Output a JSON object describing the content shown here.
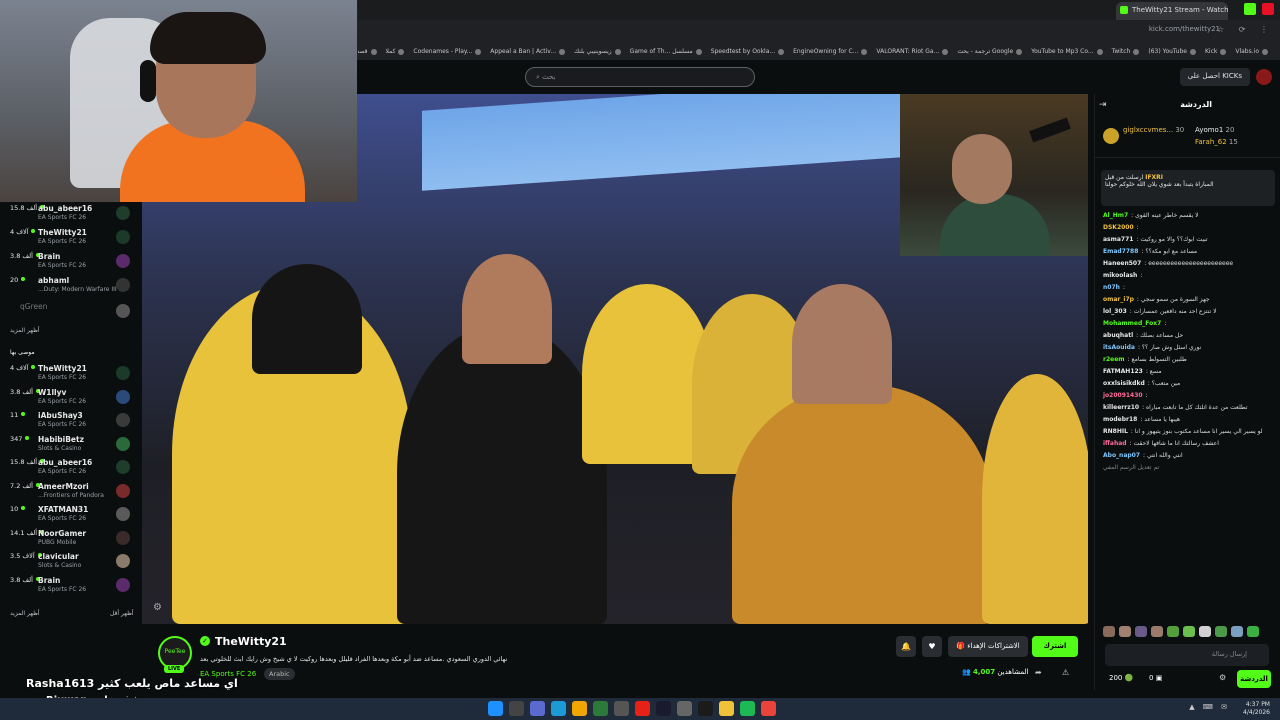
{
  "browser": {
    "tab_title": "TheWitty21 Stream - Watch",
    "url": "kick.com/thewitty21",
    "bookmarks": [
      "Vlabs.io",
      "Kick",
      "(63) YouTube",
      "Twitch",
      "YouTube to Mp3 Co...",
      "ترجمة - بحث Google",
      "VALORANT: Riot Ga...",
      "EngineOwning for C...",
      "Speedtest by Ookla...",
      "Game of Th... مسلسل",
      "زيسوينيبي بلنك",
      "Appeal a Ban | Activ...",
      "Codenames - Play...",
      "كملا",
      "قصه عشق"
    ]
  },
  "kick_nav": {
    "search_placeholder": "بحث",
    "get_kicks_label": "احصل على KICKs"
  },
  "sidebar": {
    "channels_top": [
      {
        "name": "abu_abeer16",
        "viewers": "15.8 ألف",
        "game": "EA Sports FC 26",
        "avatar": "#1e3d2a"
      },
      {
        "name": "TheWitty21",
        "viewers": "4 آلاف",
        "game": "EA Sports FC 26",
        "avatar": "#1b3a2a"
      },
      {
        "name": "Brain",
        "viewers": "3.8 ألف",
        "game": "EA Sports FC 26",
        "avatar": "#5a2a6a"
      },
      {
        "name": "abhaml",
        "viewers": "20",
        "game": "...Duty: Modern Warfare III",
        "avatar": "#333"
      }
    ],
    "offline_name": "qGreen",
    "show_more_1": "أظهر المزيد",
    "recommended_label": "موصى بها",
    "channels_recommended": [
      {
        "name": "TheWitty21",
        "viewers": "4 آلاف",
        "game": "EA Sports FC 26",
        "avatar": "#1b3a2a"
      },
      {
        "name": "W1llyv",
        "viewers": "3.8 ألف",
        "game": "EA Sports FC 26",
        "avatar": "#2a4a7a"
      },
      {
        "name": "iAbuShay3",
        "viewers": "11",
        "game": "EA Sports FC 26",
        "avatar": "#3a3a3a"
      },
      {
        "name": "HabibiBetz",
        "viewers": "347",
        "game": "Slots & Casino",
        "avatar": "#2a6a3a"
      },
      {
        "name": "abu_abeer16",
        "viewers": "15.8 ألف",
        "game": "EA Sports FC 26",
        "avatar": "#1e3d2a"
      },
      {
        "name": "AmeerMzori",
        "viewers": "7.2 ألف",
        "game": "...Frontiers of Pandora",
        "avatar": "#7a2a2a"
      },
      {
        "name": "XFATMAN31",
        "viewers": "10",
        "game": "EA Sports FC 26",
        "avatar": "#5a5a5a"
      },
      {
        "name": "NoorGamer",
        "viewers": "14.1 ألف",
        "game": "PUBG Mobile",
        "avatar": "#3a2a2a"
      },
      {
        "name": "clavicular",
        "viewers": "3.5 آلاف",
        "game": "Slots & Casino",
        "avatar": "#8a7a6a"
      },
      {
        "name": "Brain",
        "viewers": "3.8 ألف",
        "game": "EA Sports FC 26",
        "avatar": "#5a2a6a"
      }
    ],
    "show_more_2": "أظهر المزيد",
    "show_less": "أظهر أقل"
  },
  "stream": {
    "streamer_name": "TheWitty21",
    "avatar_text": "PeeTee",
    "live_label": "LIVE",
    "title": "نهائي الدوري السعودي .مساعد ضد أبو مكة وبعدها الفراد قليلل وبعدها روكيت لا ي شيخ وش رايك ابث للخلوتي بعد",
    "category": "EA Sports FC 26",
    "language": "Arabic",
    "subscribe_label": "اشترك",
    "gift_label": "الاشتراكات الإهداء",
    "viewers_label": "المشاهدين",
    "viewer_count": "4,007"
  },
  "overlay": {
    "line1_name": "Rasha1613",
    "line1_text": "اي مساعد ماص يلعب كثير",
    "line2_name": "Rjuwan",
    "line2_text": "شف خاص"
  },
  "chat": {
    "title": "الدردشة",
    "leaderboard": [
      {
        "name": "giglxccvmes...",
        "count": "30",
        "color": "#f0c23a"
      },
      {
        "name": "Ayomo1",
        "count": "20",
        "color": "#e8e8e8"
      },
      {
        "name": "Farah_62",
        "count": "15",
        "color": "#f0c23a"
      }
    ],
    "pinned_user": "IFXRI",
    "pinned_text": "المباراة بتبدأ بعد شوي يلان الله خلوكم حولنا",
    "pinned_sub": "ارسلت من قبل",
    "messages": [
      {
        "user": "Al_Hm7",
        "color": "#53fc18",
        "text": "لا يقسم خاطر عينه القوى"
      },
      {
        "user": "DSK2000",
        "color": "#f0c23a",
        "text": ""
      },
      {
        "user": "asma771",
        "color": "#e8e8e8",
        "text": "تبيت ابوك؟؟ والا مو روكيت"
      },
      {
        "user": "Emad7788",
        "color": "#7ec8ff",
        "text": "مساعد مع ابو مكة؟؟"
      },
      {
        "user": "Haneen507",
        "color": "#e8e8e8",
        "text": "eeeeeeeeeeeeeeeeeeeeeee"
      },
      {
        "user": "mikoolash",
        "color": "#e8e8e8",
        "text": ""
      },
      {
        "user": "n07h",
        "color": "#7ec8ff",
        "text": ""
      },
      {
        "user": "omar_i7p",
        "color": "#f0c23a",
        "text": "جهز السورة من سمو سجي"
      },
      {
        "user": "lol_303",
        "color": "#e8e8e8",
        "text": "لا تنتزع احد منه دافعين عمسارات"
      },
      {
        "user": "Mohammed_Fox7",
        "color": "#53fc18",
        "text": ""
      },
      {
        "user": "abuqhatl",
        "color": "#e8e8e8",
        "text": "حل مساعد بصلك"
      },
      {
        "user": "itsAouida",
        "color": "#7ec8ff",
        "text": "نوري اسئل وش صار ؟؟"
      },
      {
        "user": "r2eem",
        "color": "#53fc18",
        "text": "طلبين التسولط بسامع"
      },
      {
        "user": "FATMAH123",
        "color": "#e8e8e8",
        "text": "مسع"
      },
      {
        "user": "oxxlsisikdkd",
        "color": "#e8e8e8",
        "text": "مين متعب؟"
      },
      {
        "user": "jo20091430",
        "color": "#ff6b9a",
        "text": ""
      },
      {
        "user": "killeerrz10",
        "color": "#e8e8e8",
        "text": "تطلعت من عدة اتلتك كل ما تابعت مباراه"
      },
      {
        "user": "modebr18",
        "color": "#e8e8e8",
        "text": "هيبها يا مساعد"
      },
      {
        "user": "RN8HIL",
        "color": "#e8e8e8",
        "text": "لو يسير الي يسير انا مساعد مكتوب بنوز يتيهوز و انا"
      },
      {
        "user": "iffahad",
        "color": "#ff6b9a",
        "text": "اعشف رسالتك انا ما شافها لاحقت"
      },
      {
        "user": "Abo_nap07",
        "color": "#7ec8ff",
        "text": "انتي والله انتي"
      }
    ],
    "reply_note": "تم تعديل الرسم المفي",
    "input_placeholder": "إرسال رسالة",
    "send_label": "الدردشة",
    "kicks_count": "200",
    "zero_count": "0"
  },
  "taskbar": {
    "time": "4:37 PM",
    "date": "4/4/2026"
  }
}
